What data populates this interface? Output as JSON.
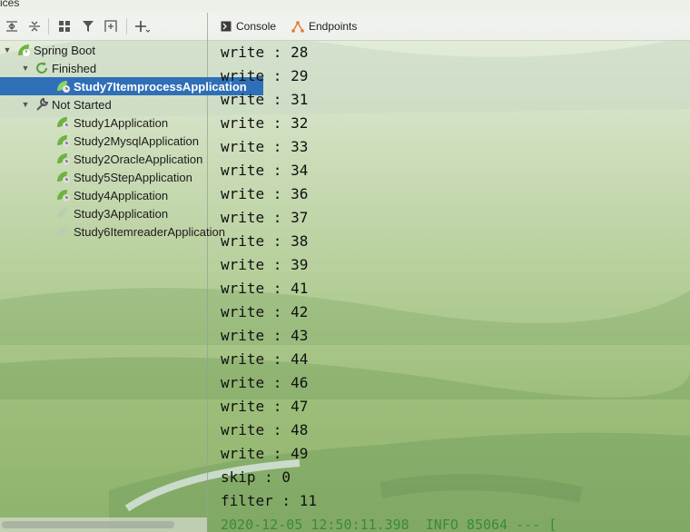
{
  "window": {
    "title_fragment": "ices"
  },
  "toolbar": {
    "buttons": [
      {
        "name": "expand-all-button",
        "icon": "expand-all-icon"
      },
      {
        "name": "collapse-all-button",
        "icon": "collapse-all-icon"
      },
      {
        "name": "group-by-button",
        "icon": "group-icon"
      },
      {
        "name": "filter-button",
        "icon": "filter-icon"
      },
      {
        "name": "new-service-button",
        "icon": "add-frame-icon"
      },
      {
        "name": "add-button",
        "icon": "plus-icon"
      }
    ]
  },
  "tabs": [
    {
      "label": "Console",
      "icon": "console-icon"
    },
    {
      "label": "Endpoints",
      "icon": "endpoints-icon"
    }
  ],
  "tree": {
    "root": {
      "label": "Spring Boot",
      "expanded": true
    },
    "groups": [
      {
        "label": "Finished",
        "expanded": true,
        "items": [
          {
            "label": "Study7ItemprocessApplication",
            "selected": true,
            "icon": "spring-run-icon"
          }
        ]
      },
      {
        "label": "Not Started",
        "expanded": true,
        "items": [
          {
            "label": "Study1Application",
            "icon": "spring-run-icon"
          },
          {
            "label": "Study2MysqlApplication",
            "icon": "spring-run-icon"
          },
          {
            "label": "Study2OracleApplication",
            "icon": "spring-run-icon"
          },
          {
            "label": "Study5StepApplication",
            "icon": "spring-run-icon"
          },
          {
            "label": "Study4Application",
            "icon": "spring-run-icon"
          },
          {
            "label": "Study3Application",
            "icon": "spring-disabled-icon"
          },
          {
            "label": "Study6ItemreaderApplication",
            "icon": "spring-disabled-icon"
          }
        ]
      }
    ]
  },
  "console": {
    "lines": [
      "write : 28",
      "write : 29",
      "write : 31",
      "write : 32",
      "write : 33",
      "write : 34",
      "write : 36",
      "write : 37",
      "write : 38",
      "write : 39",
      "write : 41",
      "write : 42",
      "write : 43",
      "write : 44",
      "write : 46",
      "write : 47",
      "write : 48",
      "write : 49",
      "skip : 0",
      "filter : 11"
    ],
    "log_line": "2020-12-05 12:50:11.398  INFO 85064 --- ["
  },
  "colors": {
    "selection": "#2f6fb7",
    "spring_green": "#6db33f",
    "log_green": "#3a8a3a"
  }
}
